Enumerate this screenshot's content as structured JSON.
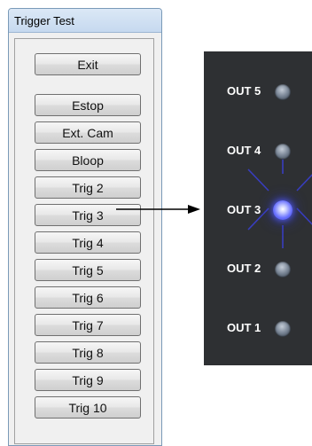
{
  "window": {
    "title": "Trigger Test"
  },
  "buttons": [
    {
      "id": "exit",
      "label": "Exit"
    },
    {
      "id": "estop",
      "label": "Estop"
    },
    {
      "id": "ext-cam",
      "label": "Ext. Cam"
    },
    {
      "id": "bloop",
      "label": "Bloop"
    },
    {
      "id": "trig-2",
      "label": "Trig 2"
    },
    {
      "id": "trig-3",
      "label": "Trig 3"
    },
    {
      "id": "trig-4",
      "label": "Trig 4"
    },
    {
      "id": "trig-5",
      "label": "Trig 5"
    },
    {
      "id": "trig-6",
      "label": "Trig 6"
    },
    {
      "id": "trig-7",
      "label": "Trig 7"
    },
    {
      "id": "trig-8",
      "label": "Trig 8"
    },
    {
      "id": "trig-9",
      "label": "Trig 9"
    },
    {
      "id": "trig-10",
      "label": "Trig 10"
    }
  ],
  "outputs": [
    {
      "label": "OUT 5",
      "lit": false
    },
    {
      "label": "OUT 4",
      "lit": false
    },
    {
      "label": "OUT 3",
      "lit": true
    },
    {
      "label": "OUT 2",
      "lit": false
    },
    {
      "label": "OUT 1",
      "lit": false
    }
  ],
  "colors": {
    "led_on": "#6a72ff",
    "panel": "#2e3033"
  }
}
